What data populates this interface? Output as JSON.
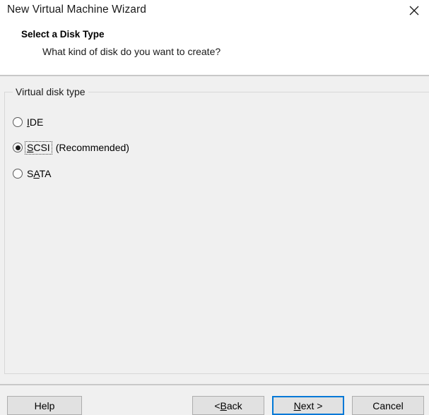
{
  "window": {
    "title": "New Virtual Machine Wizard",
    "close_icon": "close-icon"
  },
  "page": {
    "heading": "Select a Disk Type",
    "subheading": "What kind of disk do you want to create?"
  },
  "group": {
    "label": "Virtual disk type",
    "options": [
      {
        "id": "ide",
        "label": "IDE",
        "accel_prefix": "",
        "accel": "I",
        "accel_suffix": "DE",
        "suffix": "",
        "checked": false,
        "focused": false
      },
      {
        "id": "scsi",
        "label": "SCSI",
        "accel_prefix": "",
        "accel": "S",
        "accel_suffix": "CSI",
        "suffix": "(Recommended)",
        "checked": true,
        "focused": true
      },
      {
        "id": "sata",
        "label": "SATA",
        "accel_prefix": "S",
        "accel": "A",
        "accel_suffix": "TA",
        "suffix": "",
        "checked": false,
        "focused": false
      }
    ]
  },
  "footer": {
    "help": {
      "label": "Help",
      "accel_prefix": "Help",
      "accel": "",
      "accel_suffix": ""
    },
    "back": {
      "label": "< Back",
      "accel_prefix": "< ",
      "accel": "B",
      "accel_suffix": "ack"
    },
    "next": {
      "label": "Next >",
      "accel_prefix": "",
      "accel": "N",
      "accel_suffix": "ext >",
      "is_default": true
    },
    "cancel": {
      "label": "Cancel",
      "accel_prefix": "Cancel",
      "accel": "",
      "accel_suffix": ""
    }
  },
  "colors": {
    "header_background": "#ffffff",
    "body_background": "#f0f0f0",
    "separator": "#c8c8c8",
    "groupbox_border": "#d7d7d7",
    "button_face": "#e1e1e1",
    "button_border": "#adadad",
    "default_button_focus": "#0078d7",
    "text": "#000000"
  }
}
